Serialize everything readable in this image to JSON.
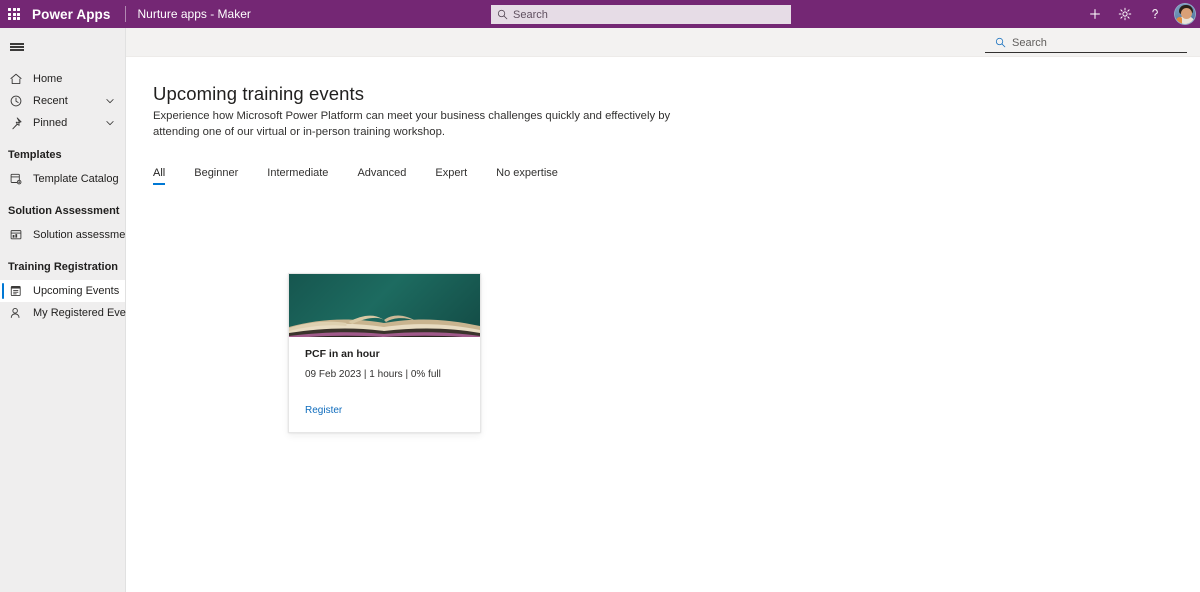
{
  "header": {
    "waffle_icon": "waffle-icon",
    "brand": "Power Apps",
    "environment": "Nurture apps - Maker",
    "search": {
      "placeholder": "Search",
      "value": "",
      "icon": "search-icon"
    },
    "actions": [
      {
        "name": "new",
        "icon": "plus-icon",
        "glyph": "+"
      },
      {
        "name": "settings",
        "icon": "gear-icon",
        "glyph": "⚙"
      },
      {
        "name": "help",
        "icon": "question-icon",
        "glyph": "?"
      }
    ],
    "avatar_label": "account-avatar",
    "background_color": "#742774"
  },
  "sidebar": {
    "toggle_icon": "hamburger-icon",
    "items": [
      {
        "label": "Home",
        "icon": "home-icon",
        "expandable": false,
        "selected": false
      },
      {
        "label": "Recent",
        "icon": "clock-icon",
        "expandable": true,
        "selected": false
      },
      {
        "label": "Pinned",
        "icon": "pin-icon",
        "expandable": true,
        "selected": false
      }
    ],
    "groups": [
      {
        "title": "Templates",
        "items": [
          {
            "label": "Template Catalog",
            "icon": "template-catalog-icon",
            "selected": false
          }
        ]
      },
      {
        "title": "Solution Assessment",
        "items": [
          {
            "label": "Solution assessment",
            "icon": "solution-assessment-icon",
            "selected": false
          }
        ]
      },
      {
        "title": "Training Registration",
        "items": [
          {
            "label": "Upcoming Events",
            "icon": "calendar-list-icon",
            "selected": true
          },
          {
            "label": "My Registered Events",
            "icon": "person-icon",
            "selected": false
          }
        ]
      }
    ],
    "selected_accent_color": "#0078d4",
    "background_color": "#efeeee"
  },
  "commandbar": {
    "search": {
      "placeholder": "Search",
      "value": "",
      "icon": "search-icon"
    }
  },
  "main": {
    "title": "Upcoming training events",
    "description": "Experience how Microsoft Power Platform can meet your business challenges quickly and effectively by attending one of our virtual or in-person training workshop.",
    "tabs": [
      {
        "label": "All",
        "active": true
      },
      {
        "label": "Beginner",
        "active": false
      },
      {
        "label": "Intermediate",
        "active": false
      },
      {
        "label": "Advanced",
        "active": false
      },
      {
        "label": "Expert",
        "active": false
      },
      {
        "label": "No expertise",
        "active": false
      }
    ],
    "tab_accent_color": "#0078d4",
    "cards": [
      {
        "title": "PCF in an hour",
        "meta": "09 Feb 2023 | 1 hours | 0% full",
        "link_label": "Register",
        "image_alt": "open-book-photo",
        "image_color": "#1d6b60",
        "link_color": "#0f6cbd"
      }
    ]
  }
}
